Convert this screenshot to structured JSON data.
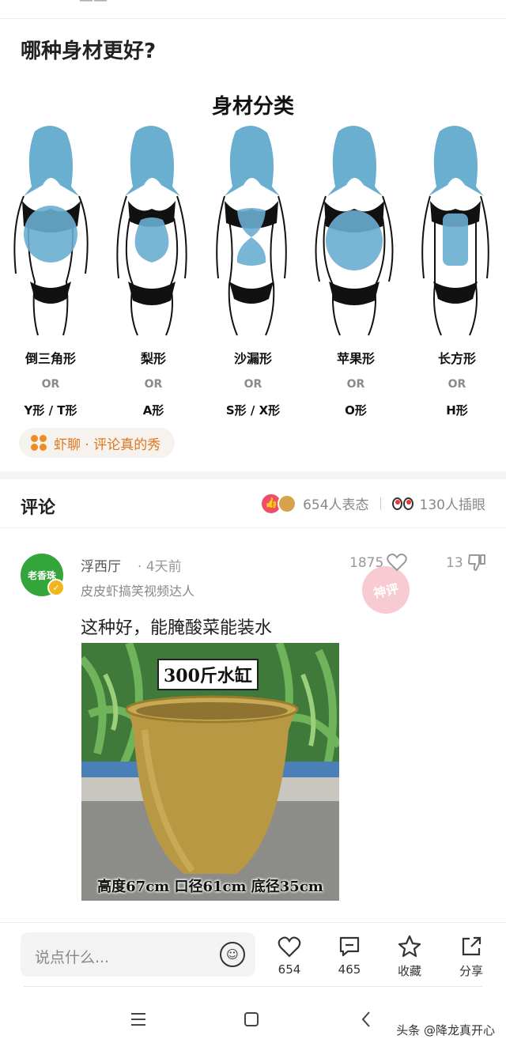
{
  "post": {
    "title": "哪种身材更好?"
  },
  "figure": {
    "title": "身材分类",
    "shapes": [
      {
        "name": "倒三角形",
        "or": "OR",
        "alt": "Y形 / T形"
      },
      {
        "name": "梨形",
        "or": "OR",
        "alt": "A形"
      },
      {
        "name": "沙漏形",
        "or": "OR",
        "alt": "S形 / X形"
      },
      {
        "name": "苹果形",
        "or": "OR",
        "alt": "O形"
      },
      {
        "name": "长方形",
        "or": "OR",
        "alt": "H形"
      }
    ]
  },
  "tag": {
    "label": "虾聊 · 评论真的秀"
  },
  "comments": {
    "title": "评论",
    "reactions_text": "654人表态",
    "eyes_text": "130人插眼"
  },
  "comment": {
    "avatar_text": "老香珠",
    "username": "浮西厅",
    "time": "· 4天前",
    "description": "皮皮虾搞笑视频达人",
    "likes": "1875",
    "dislikes": "13",
    "stamp": "神评",
    "text": "这种好，能腌酸菜能装水",
    "image_label": "300斤水缸",
    "image_caption": "高度67cm  口径61cm  底径35cm"
  },
  "bottom": {
    "input_placeholder": "说点什么...",
    "like_count": "654",
    "comment_count": "465",
    "favorite_label": "收藏",
    "share_label": "分享"
  },
  "watermark": "头条 @降龙真开心",
  "colors": {
    "accent_orange": "#e0761c",
    "body_blue": "#6aaed0",
    "avatar_green": "#34a53a"
  }
}
